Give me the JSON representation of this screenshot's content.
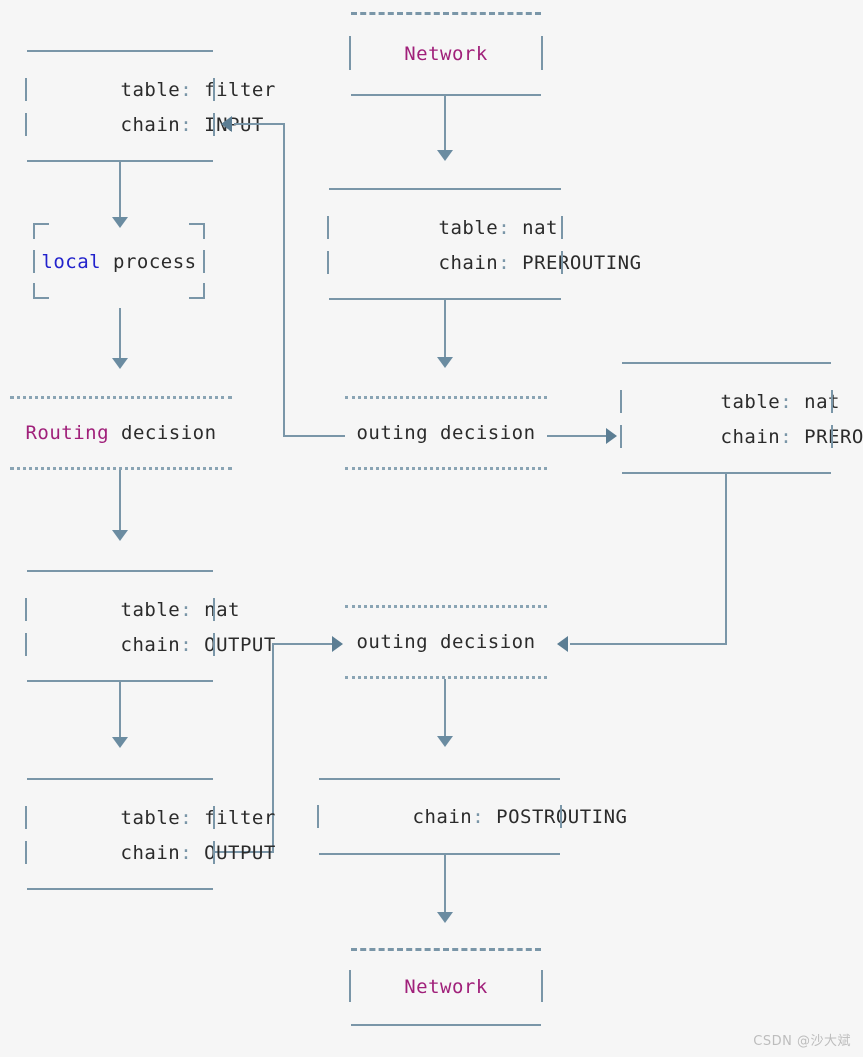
{
  "canvas": {
    "background": "#f6f6f6",
    "line_color": "#7a96a8",
    "arrow_color": "#5b7d93",
    "text_color": "#2b2b2b",
    "accent_magenta": "#a0207a",
    "accent_blue": "#2222cc"
  },
  "nodes": {
    "network_top": {
      "label": "Network",
      "style": "dashed-top-box"
    },
    "filter_input": {
      "line1_key": "table",
      "line1_value": "filter",
      "line2_key": "chain",
      "line2_value": "INPUT",
      "colon": ":"
    },
    "local_process": {
      "word1": "local",
      "word2": " process",
      "style": "corner-bracket-box"
    },
    "routing_decision_left": {
      "word1": "Routing",
      "word2": " decision",
      "style": "dotted-rule"
    },
    "nat_prerouting_top": {
      "line1_key": "table",
      "line1_value": "nat",
      "line2_key": "chain",
      "line2_value": "PREROUTING",
      "colon": ":"
    },
    "routing_decision_middle": {
      "text": "outing decision",
      "style": "dotted-rule"
    },
    "nat_prerouting_right": {
      "line1_key": "table",
      "line1_value": "nat",
      "line2_key": "chain",
      "line2_value": "PREROUTING",
      "colon": ":"
    },
    "nat_output": {
      "line1_key": "table",
      "line1_value": "nat",
      "line2_key": "chain",
      "line2_value": "OUTPUT",
      "colon": ":"
    },
    "routing_decision_lower": {
      "text": "outing decision",
      "style": "dotted-rule"
    },
    "filter_output": {
      "line1_key": "table",
      "line1_value": "filter",
      "line2_key": "chain",
      "line2_value": "OUTPUT",
      "colon": ":"
    },
    "postrouting": {
      "line1_key": "chain",
      "line1_value": "POSTROUTING",
      "colon": ":"
    },
    "network_bottom": {
      "label": "Network",
      "style": "dashed-top-box"
    }
  },
  "watermark": {
    "text": "CSDN @沙大斌"
  }
}
